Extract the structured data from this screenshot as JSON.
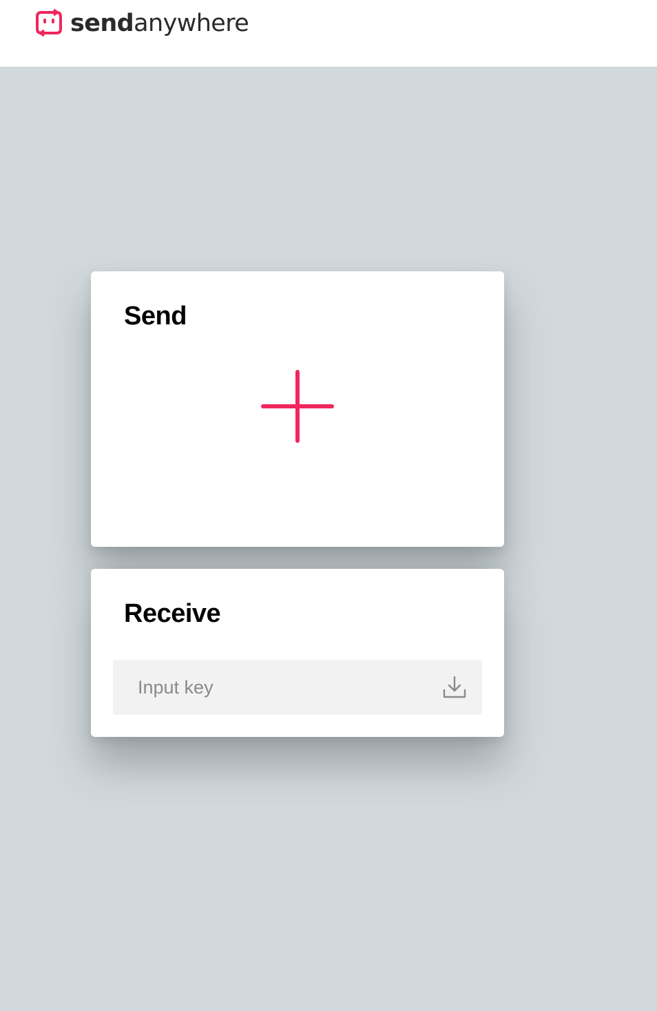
{
  "header": {
    "brand_bold": "send",
    "brand_regular": "anywhere"
  },
  "send": {
    "title": "Send",
    "add_icon": "plus-icon"
  },
  "receive": {
    "title": "Receive",
    "key_placeholder": "Input key",
    "key_value": "",
    "download_icon": "download-icon"
  },
  "colors": {
    "accent": "#f0265c",
    "background": "#d2d9dc",
    "card": "#ffffff",
    "input_bg": "#f2f2f2"
  }
}
